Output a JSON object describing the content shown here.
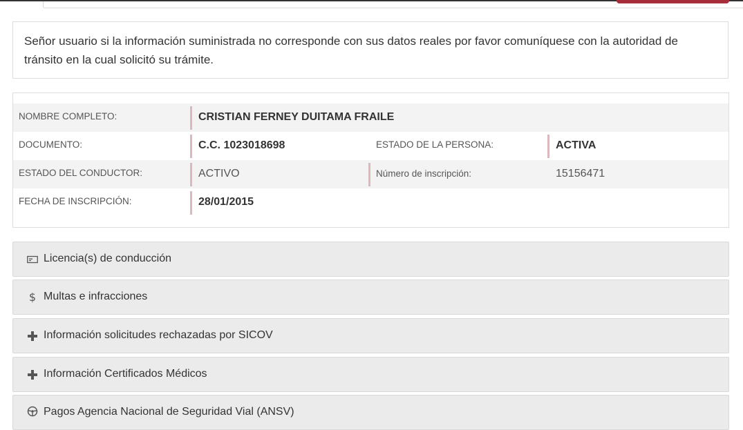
{
  "notice": {
    "text": "Señor usuario si la información suministrada no corresponde con sus datos reales por favor comuníquese con la autoridad de tránsito en la cual solicitó su trámite."
  },
  "person": {
    "nombre_label": "NOMBRE COMPLETO:",
    "nombre_value": "CRISTIAN FERNEY DUITAMA FRAILE",
    "documento_label": "DOCUMENTO:",
    "documento_value": "C.C. 1023018698",
    "estado_persona_label": "ESTADO DE LA PERSONA:",
    "estado_persona_value": "ACTIVA",
    "estado_conductor_label": "ESTADO DEL CONDUCTOR:",
    "estado_conductor_value": "ACTIVO",
    "numero_inscripcion_label": "Número de inscripción:",
    "numero_inscripcion_value": "15156471",
    "fecha_inscripcion_label": "FECHA DE INSCRIPCIÓN:",
    "fecha_inscripcion_value": "28/01/2015"
  },
  "panels": [
    {
      "icon": "id-card-icon",
      "title": "Licencia(s) de conducción"
    },
    {
      "icon": "dollar-icon",
      "title": "Multas e infracciones"
    },
    {
      "icon": "cross-icon",
      "title": "Información solicitudes rechazadas por SICOV"
    },
    {
      "icon": "cross-icon",
      "title": "Información Certificados Médicos"
    },
    {
      "icon": "steering-wheel-icon",
      "title": "Pagos Agencia Nacional de Seguridad Vial (ANSV)"
    }
  ],
  "colors": {
    "accent_border": "#dcb8bc",
    "brand_red": "#a72e3a",
    "panel_bg": "#ebebeb"
  }
}
